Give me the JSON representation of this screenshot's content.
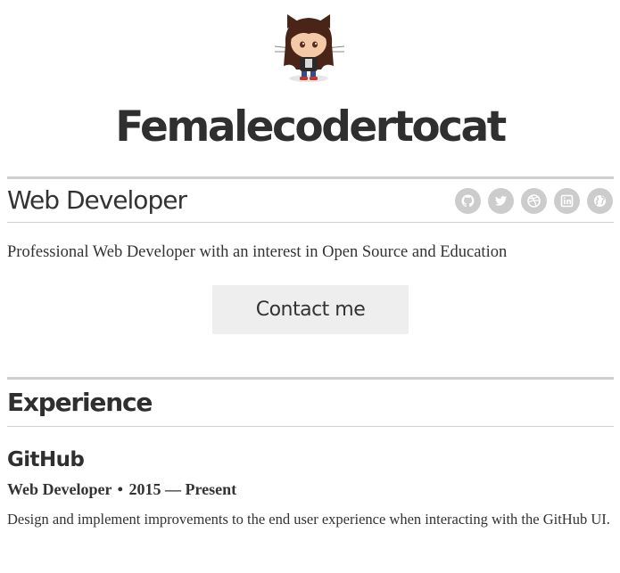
{
  "header": {
    "name": "Femalecodertocat",
    "avatar_icon": "femalecodertocat-avatar"
  },
  "profile": {
    "job_title": "Web Developer",
    "summary": "Professional Web Developer with an interest in Open Source and Education",
    "contact_label": "Contact me",
    "social_links": [
      {
        "icon": "github-icon"
      },
      {
        "icon": "twitter-icon"
      },
      {
        "icon": "dribbble-icon"
      },
      {
        "icon": "linkedin-icon"
      },
      {
        "icon": "globe-icon"
      }
    ]
  },
  "experience": {
    "heading": "Experience",
    "items": [
      {
        "company": "GitHub",
        "role": "Web Developer",
        "separator": "•",
        "period": "2015 — Present",
        "description": "Design and implement improvements to the end user experience when interacting with the GitHub UI."
      }
    ]
  },
  "colors": {
    "text": "#333333",
    "rule": "#cfcfcf",
    "button_bg": "#eeeeee",
    "icon_bg": "#cccccc"
  }
}
